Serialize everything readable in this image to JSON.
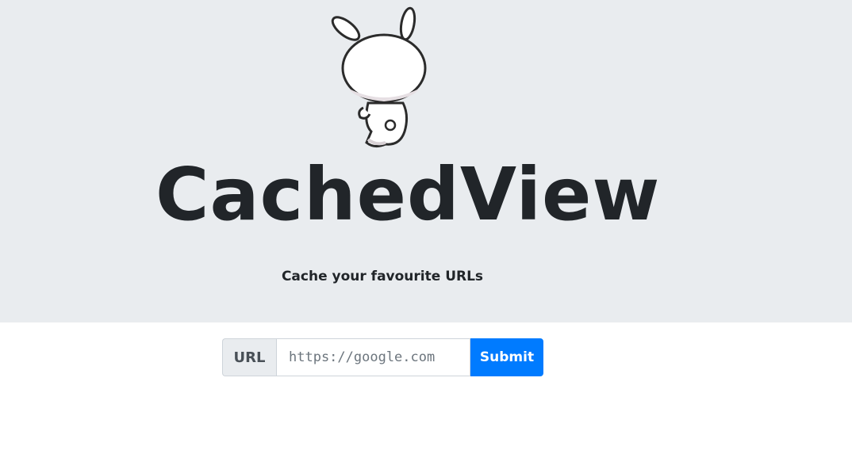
{
  "hero": {
    "title": "CachedView",
    "subtitle": "Cache your favourite URLs",
    "mascot_icon": "bunny-mascot-icon"
  },
  "form": {
    "prepend_label": "URL",
    "url_placeholder": "https://google.com",
    "url_value": "",
    "submit_label": "Submit"
  },
  "colors": {
    "hero_background": "#e9ecef",
    "accent": "#007bff",
    "text": "#212529"
  }
}
